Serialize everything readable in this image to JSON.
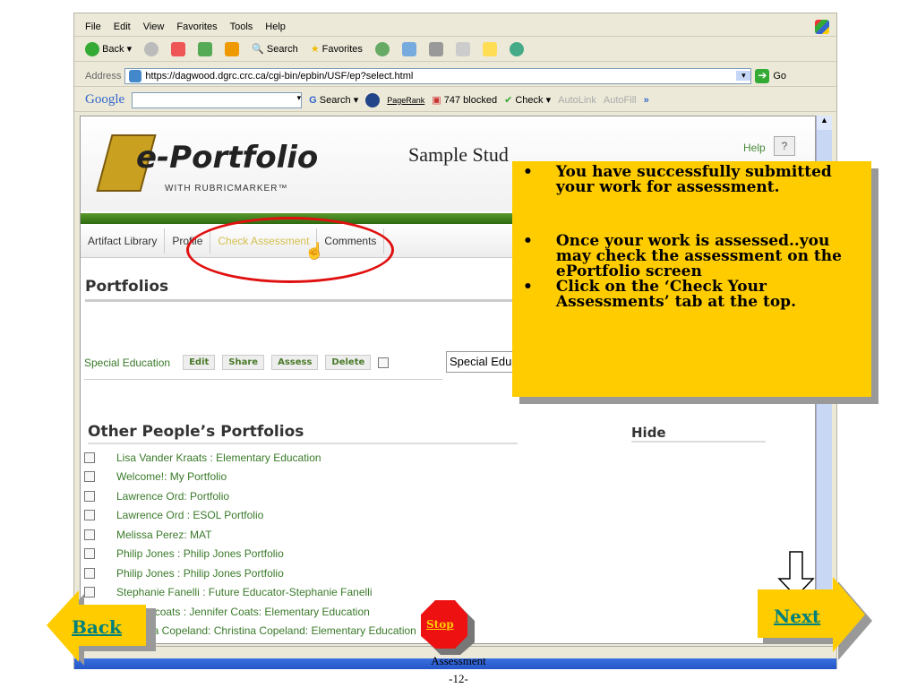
{
  "browser": {
    "menu": [
      "File",
      "Edit",
      "View",
      "Favorites",
      "Tools",
      "Help"
    ],
    "toolbar": {
      "back": "Back",
      "search": "Search",
      "favorites": "Favorites"
    },
    "address_label": "Address",
    "url": "https://dagwood.dgrc.crc.ca/cgi-bin/epbin/USF/ep?select.html",
    "go": "Go",
    "google": {
      "logo": "Google",
      "search": "Search",
      "pagerank": "PageRank",
      "blocked": "747 blocked",
      "check": "Check",
      "autolink": "AutoLink",
      "autofill": "AutoFill"
    }
  },
  "page": {
    "logo": "e-Portfolio",
    "logo_sub": "WITH RUBRICMARKER™",
    "title": "Sample Stud",
    "help": "Help",
    "help_btn": "?",
    "tabs": [
      "Artifact Library",
      "Profile",
      "Check Assessment",
      "Comments"
    ],
    "portfolios_heading": "Portfolios",
    "portfolio_name": "Special Education",
    "buttons": [
      "Edit",
      "Share",
      "Assess",
      "Delete"
    ],
    "select_value": "Special Edu",
    "others_heading": "Other People’s Portfolios",
    "hide": "Hide",
    "others": [
      "Lisa Vander Kraats : Elementary Education",
      "Welcome!: My Portfolio",
      "Lawrence Ord: Portfolio",
      "Lawrence Ord : ESOL Portfolio",
      "Melissa Perez: MAT",
      "Philip Jones : Philip Jones Portfolio",
      "Philip Jones : Philip Jones Portfolio",
      "Stephanie Fanelli : Future Educator-Stephanie Fanelli",
      "jennifer coats : Jennifer Coats: Elementary Education",
      "Christina Copeland: Christina Copeland: Elementary Education"
    ]
  },
  "callout": [
    "You have successfully submitted your work for assessment.",
    "Once your work is assessed..you may check the assessment on the ePortfolio screen",
    "Click on the ‘Check Your Assessments’ tab at the top."
  ],
  "slide": {
    "back": "Back",
    "next": "Next",
    "stop": "Stop",
    "caption": "Assessment",
    "page": "-12-"
  }
}
